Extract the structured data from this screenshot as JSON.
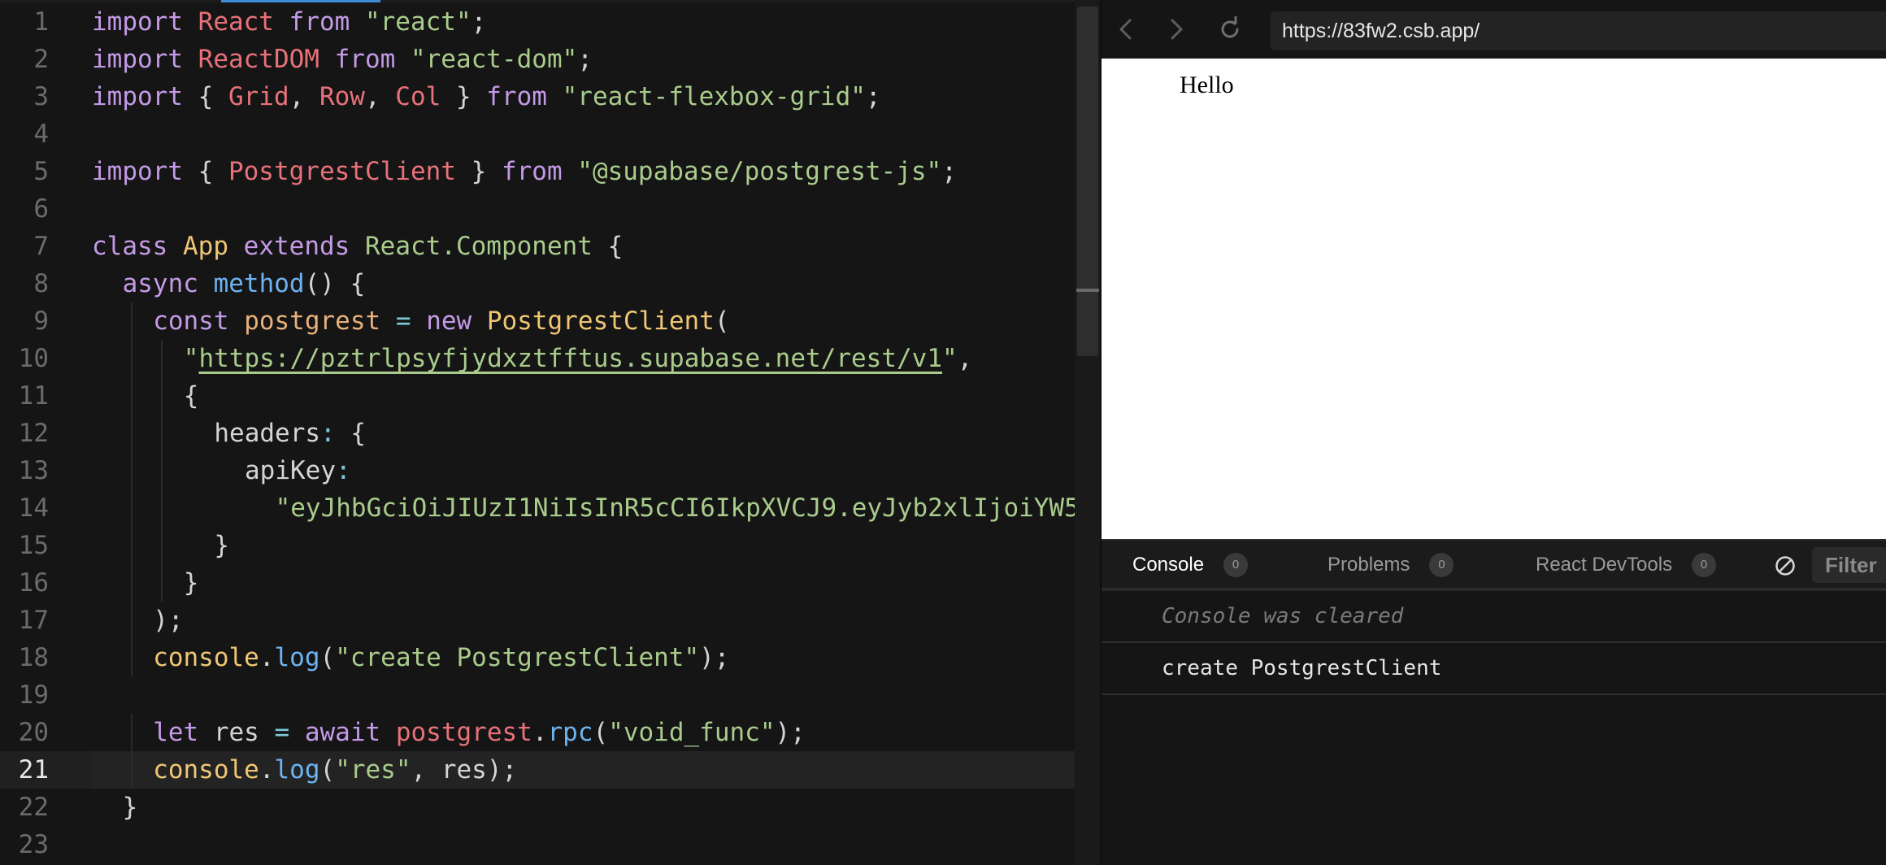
{
  "editor": {
    "lines": [
      {
        "n": "1",
        "indent": 0,
        "tokens": [
          [
            "kw",
            "import"
          ],
          [
            "pun",
            " "
          ],
          [
            "id",
            "React"
          ],
          [
            "pun",
            " "
          ],
          [
            "kw",
            "from"
          ],
          [
            "pun",
            " "
          ],
          [
            "str",
            "\"react\""
          ],
          [
            "pun",
            ";"
          ]
        ]
      },
      {
        "n": "2",
        "indent": 0,
        "tokens": [
          [
            "kw",
            "import"
          ],
          [
            "pun",
            " "
          ],
          [
            "id",
            "ReactDOM"
          ],
          [
            "pun",
            " "
          ],
          [
            "kw",
            "from"
          ],
          [
            "pun",
            " "
          ],
          [
            "str",
            "\"react-dom\""
          ],
          [
            "pun",
            ";"
          ]
        ]
      },
      {
        "n": "3",
        "indent": 0,
        "tokens": [
          [
            "kw",
            "import"
          ],
          [
            "pun",
            " { "
          ],
          [
            "id",
            "Grid"
          ],
          [
            "pun",
            ", "
          ],
          [
            "id",
            "Row"
          ],
          [
            "pun",
            ", "
          ],
          [
            "id",
            "Col"
          ],
          [
            "pun",
            " } "
          ],
          [
            "kw",
            "from"
          ],
          [
            "pun",
            " "
          ],
          [
            "str",
            "\"react-flexbox-grid\""
          ],
          [
            "pun",
            ";"
          ]
        ]
      },
      {
        "n": "4",
        "indent": 0,
        "tokens": []
      },
      {
        "n": "5",
        "indent": 0,
        "tokens": [
          [
            "kw",
            "import"
          ],
          [
            "pun",
            " { "
          ],
          [
            "id",
            "PostgrestClient"
          ],
          [
            "pun",
            " } "
          ],
          [
            "kw",
            "from"
          ],
          [
            "pun",
            " "
          ],
          [
            "str",
            "\"@supabase/postgrest-js\""
          ],
          [
            "pun",
            ";"
          ]
        ]
      },
      {
        "n": "6",
        "indent": 0,
        "tokens": []
      },
      {
        "n": "7",
        "indent": 0,
        "tokens": [
          [
            "kw",
            "class"
          ],
          [
            "pun",
            " "
          ],
          [
            "cls",
            "App"
          ],
          [
            "pun",
            " "
          ],
          [
            "kw",
            "extends"
          ],
          [
            "pun",
            " "
          ],
          [
            "inh",
            "React.Component"
          ],
          [
            "pun",
            " {"
          ]
        ]
      },
      {
        "n": "8",
        "indent": 1,
        "tokens": [
          [
            "kw",
            "async"
          ],
          [
            "pun",
            " "
          ],
          [
            "fn",
            "method"
          ],
          [
            "pun",
            "() {"
          ]
        ]
      },
      {
        "n": "9",
        "indent": 2,
        "tokens": [
          [
            "kw",
            "const"
          ],
          [
            "pun",
            " "
          ],
          [
            "var",
            "postgrest"
          ],
          [
            "pun",
            " "
          ],
          [
            "op",
            "="
          ],
          [
            "pun",
            " "
          ],
          [
            "kw",
            "new"
          ],
          [
            "pun",
            " "
          ],
          [
            "cls",
            "PostgrestClient"
          ],
          [
            "pun",
            "("
          ]
        ]
      },
      {
        "n": "10",
        "indent": 3,
        "tokens": [
          [
            "str",
            "\""
          ],
          [
            "url",
            "https://pztrlpsyfjydxztfftus.supabase.net/rest/v1"
          ],
          [
            "str",
            "\""
          ],
          [
            "pun",
            ","
          ]
        ]
      },
      {
        "n": "11",
        "indent": 3,
        "tokens": [
          [
            "pun",
            "{"
          ]
        ]
      },
      {
        "n": "12",
        "indent": 4,
        "tokens": [
          [
            "prop",
            "headers"
          ],
          [
            "op",
            ":"
          ],
          [
            "pun",
            " {"
          ]
        ]
      },
      {
        "n": "13",
        "indent": 5,
        "tokens": [
          [
            "prop",
            "apiKey"
          ],
          [
            "op",
            ":"
          ]
        ]
      },
      {
        "n": "14",
        "indent": 6,
        "tokens": [
          [
            "str",
            "\"eyJhbGciOiJIUzI1NiIsInR5cCI6IkpXVCJ9.eyJyb2xlIjoiYW5"
          ]
        ]
      },
      {
        "n": "15",
        "indent": 4,
        "tokens": [
          [
            "pun",
            "}"
          ]
        ]
      },
      {
        "n": "16",
        "indent": 3,
        "tokens": [
          [
            "pun",
            "}"
          ]
        ]
      },
      {
        "n": "17",
        "indent": 2,
        "tokens": [
          [
            "pun",
            ");"
          ]
        ]
      },
      {
        "n": "18",
        "indent": 2,
        "tokens": [
          [
            "cls",
            "console"
          ],
          [
            "pun",
            "."
          ],
          [
            "fn",
            "log"
          ],
          [
            "pun",
            "("
          ],
          [
            "str",
            "\"create PostgrestClient\""
          ],
          [
            "pun",
            ");"
          ]
        ]
      },
      {
        "n": "19",
        "indent": 0,
        "tokens": []
      },
      {
        "n": "20",
        "indent": 2,
        "tokens": [
          [
            "kw",
            "let"
          ],
          [
            "pun",
            " res "
          ],
          [
            "op",
            "="
          ],
          [
            "pun",
            " "
          ],
          [
            "kw",
            "await"
          ],
          [
            "pun",
            " "
          ],
          [
            "id",
            "postgrest"
          ],
          [
            "pun",
            "."
          ],
          [
            "fn",
            "rpc"
          ],
          [
            "pun",
            "("
          ],
          [
            "str",
            "\"void_func\""
          ],
          [
            "pun",
            ");"
          ]
        ]
      },
      {
        "n": "21",
        "indent": 2,
        "current": true,
        "tokens": [
          [
            "cls",
            "console"
          ],
          [
            "pun",
            "."
          ],
          [
            "fn",
            "log"
          ],
          [
            "pun",
            "("
          ],
          [
            "str",
            "\"res\""
          ],
          [
            "pun",
            ", res);"
          ]
        ]
      },
      {
        "n": "22",
        "indent": 1,
        "tokens": [
          [
            "pun",
            "}"
          ]
        ]
      },
      {
        "n": "23",
        "indent": 0,
        "tokens": []
      }
    ]
  },
  "browser": {
    "url": "https://83fw2.csb.app/",
    "back_icon": "chevron-left-icon",
    "forward_icon": "chevron-right-icon",
    "reload_icon": "reload-icon",
    "preview_text": "Hello"
  },
  "devtools": {
    "tabs": [
      {
        "label": "Console",
        "count": "0",
        "active": true
      },
      {
        "label": "Problems",
        "count": "0",
        "active": false
      },
      {
        "label": "React DevTools",
        "count": "0",
        "active": false
      }
    ],
    "filter_label": "Filter",
    "console": {
      "cleared_text": "Console was cleared",
      "messages": [
        "create PostgrestClient"
      ]
    }
  },
  "colors": {
    "keyword": "#c49ae6",
    "identifier": "#e8717a",
    "string": "#a9cc8c",
    "class": "#f0c674",
    "function": "#6db3f2",
    "variable": "#e8b07a",
    "background": "#151515"
  }
}
